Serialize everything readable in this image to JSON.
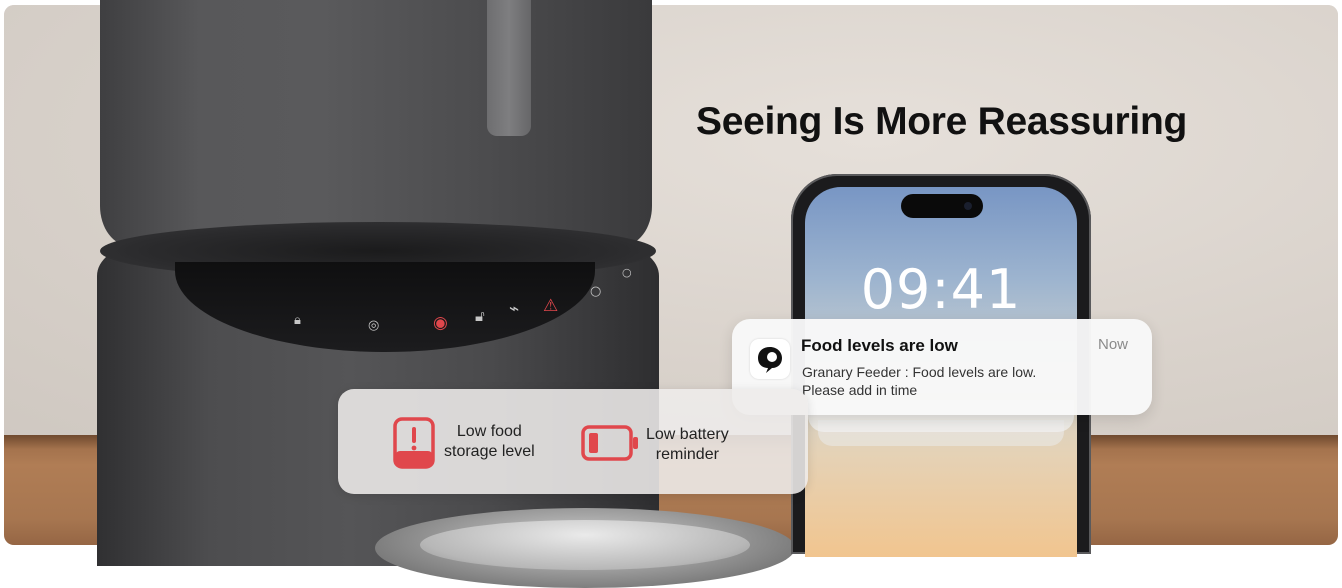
{
  "headline": "Seeing Is More Reassuring",
  "phone": {
    "time": "09:41"
  },
  "notification": {
    "title": "Food levels are low",
    "time": "Now",
    "body_line1": "Granary Feeder : Food levels are low.",
    "body_line2": "Please add in time",
    "app_icon": "granary-app-icon"
  },
  "alerts": [
    {
      "icon": "low-food-storage-icon",
      "line1": "Low food",
      "line2": "storage level"
    },
    {
      "icon": "low-battery-icon",
      "line1": "Low battery",
      "line2": "reminder"
    }
  ],
  "colors": {
    "alert_red": "#e0474c",
    "headline": "#111111"
  }
}
